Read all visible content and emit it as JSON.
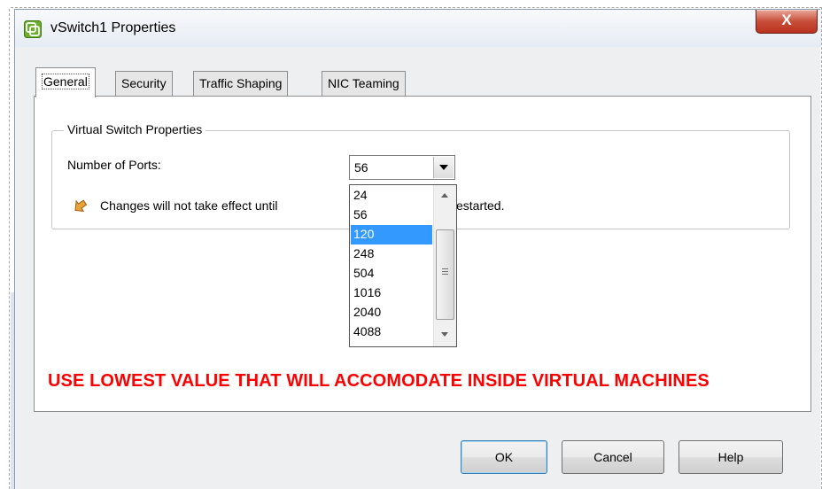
{
  "window": {
    "title": "vSwitch1 Properties",
    "close_label": "X"
  },
  "tabs": [
    {
      "label": "General",
      "active": true
    },
    {
      "label": "Security",
      "active": false
    },
    {
      "label": "Traffic Shaping",
      "active": false
    },
    {
      "label": "NIC Teaming",
      "active": false
    }
  ],
  "group": {
    "legend": "Virtual Switch Properties",
    "ports_label": "Number of Ports:",
    "ports_value": "56",
    "warning_text_before": "Changes will not take effect until",
    "warning_text_after": "estarted."
  },
  "dropdown": {
    "options": [
      "24",
      "56",
      "120",
      "248",
      "504",
      "1016",
      "2040",
      "4088"
    ],
    "highlighted": "120"
  },
  "advice": "USE LOWEST VALUE THAT WILL ACCOMODATE INSIDE VIRTUAL MACHINES",
  "buttons": {
    "ok": "OK",
    "cancel": "Cancel",
    "help": "Help"
  },
  "colors": {
    "advice": "#ff0000",
    "selection": "#3399ff",
    "close_button": "#c94f3a"
  },
  "icons": {
    "app": "vmware-app-icon",
    "warning": "warning-arrow-icon",
    "close": "close-icon"
  }
}
